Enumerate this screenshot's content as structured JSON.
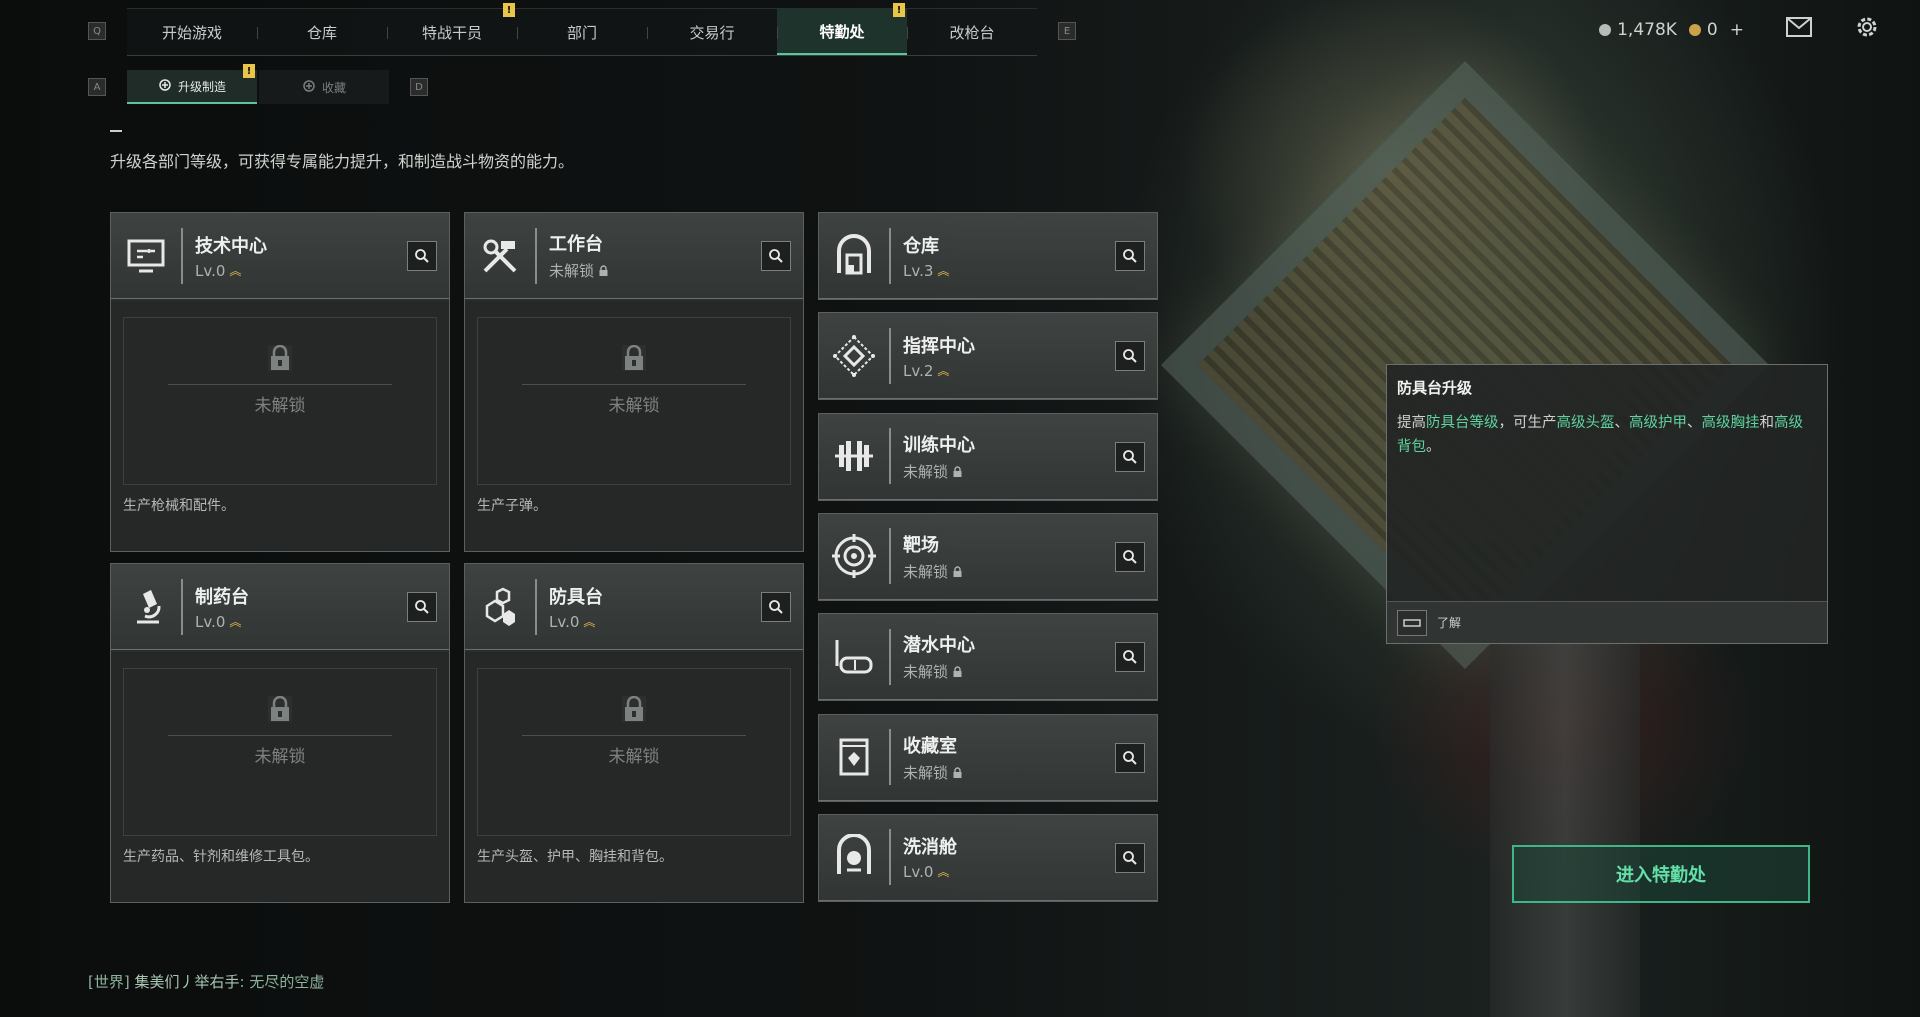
{
  "nav": {
    "key_left": "Q",
    "key_right": "E",
    "tabs": [
      {
        "label": "开始游戏",
        "active": false,
        "alert": false
      },
      {
        "label": "仓库",
        "active": false,
        "alert": false
      },
      {
        "label": "特战干员",
        "active": false,
        "alert": true
      },
      {
        "label": "部门",
        "active": false,
        "alert": false
      },
      {
        "label": "交易行",
        "active": false,
        "alert": false
      },
      {
        "label": "特勤处",
        "active": true,
        "alert": true
      },
      {
        "label": "改枪台",
        "active": false,
        "alert": false
      }
    ],
    "alert_glyph": "!"
  },
  "subnav": {
    "key_left": "A",
    "key_right": "D",
    "tabs": [
      {
        "label": "升级制造",
        "icon": "upgrade-icon",
        "active": true
      },
      {
        "label": "收藏",
        "icon": "collection-icon",
        "active": false
      }
    ]
  },
  "currency": {
    "silver": "1,478K",
    "gold": "0",
    "plus": "+",
    "silver_color": "#b8bcb9",
    "gold_color": "#c9a24a"
  },
  "description": "升级各部门等级，可获得专属能力提升，和制造战斗物资的能力。",
  "big_cards": [
    {
      "name": "技术中心",
      "status": "Lv.0",
      "icon": "computer-icon",
      "locked_label": "未解锁",
      "produce": "生产枪械和配件。",
      "locked": false
    },
    {
      "name": "工作台",
      "status": "未解锁",
      "icon": "hammer-wrench-icon",
      "locked_label": "未解锁",
      "produce": "生产子弹。",
      "locked": true
    },
    {
      "name": "制药台",
      "status": "Lv.0",
      "icon": "microscope-icon",
      "locked_label": "未解锁",
      "produce": "生产药品、针剂和维修工具包。",
      "locked": false
    },
    {
      "name": "防具台",
      "status": "Lv.0",
      "icon": "armor-icon",
      "locked_label": "未解锁",
      "produce": "生产头盔、护甲、胸挂和背包。",
      "locked": false
    }
  ],
  "small_cards": [
    {
      "name": "仓库",
      "status": "Lv.3",
      "icon": "warehouse-icon",
      "locked": false
    },
    {
      "name": "指挥中心",
      "status": "Lv.2",
      "icon": "command-icon",
      "locked": false
    },
    {
      "name": "训练中心",
      "status": "未解锁",
      "icon": "dumbbell-icon",
      "locked": true
    },
    {
      "name": "靶场",
      "status": "未解锁",
      "icon": "target-icon",
      "locked": true
    },
    {
      "name": "潜水中心",
      "status": "未解锁",
      "icon": "diving-mask-icon",
      "locked": true
    },
    {
      "name": "收藏室",
      "status": "未解锁",
      "icon": "collection-room-icon",
      "locked": true
    },
    {
      "name": "洗消舱",
      "status": "Lv.0",
      "icon": "decon-icon",
      "locked": false
    }
  ],
  "tooltip": {
    "title": "防具台升级",
    "desc_parts": [
      {
        "text": "提高",
        "hl": false
      },
      {
        "text": "防具台等级",
        "hl": true
      },
      {
        "text": "，可生产",
        "hl": false
      },
      {
        "text": "高级头盔",
        "hl": true
      },
      {
        "text": "、",
        "hl": false
      },
      {
        "text": "高级护甲",
        "hl": true
      },
      {
        "text": "、",
        "hl": false
      },
      {
        "text": "高级胸挂",
        "hl": true
      },
      {
        "text": "和",
        "hl": false
      },
      {
        "text": "高级背包",
        "hl": true
      },
      {
        "text": "。",
        "hl": false
      }
    ],
    "footer_label": "了解"
  },
  "enter_button": "进入特勤处",
  "chat": {
    "channel": "[世界]",
    "sender": "集美们丿举右手",
    "message": "无尽的空虚"
  },
  "colors": {
    "accent": "#58c79b",
    "highlight": "#5fd3a0",
    "alert": "#e9c54a",
    "level_chevron": "#e6b94a"
  }
}
